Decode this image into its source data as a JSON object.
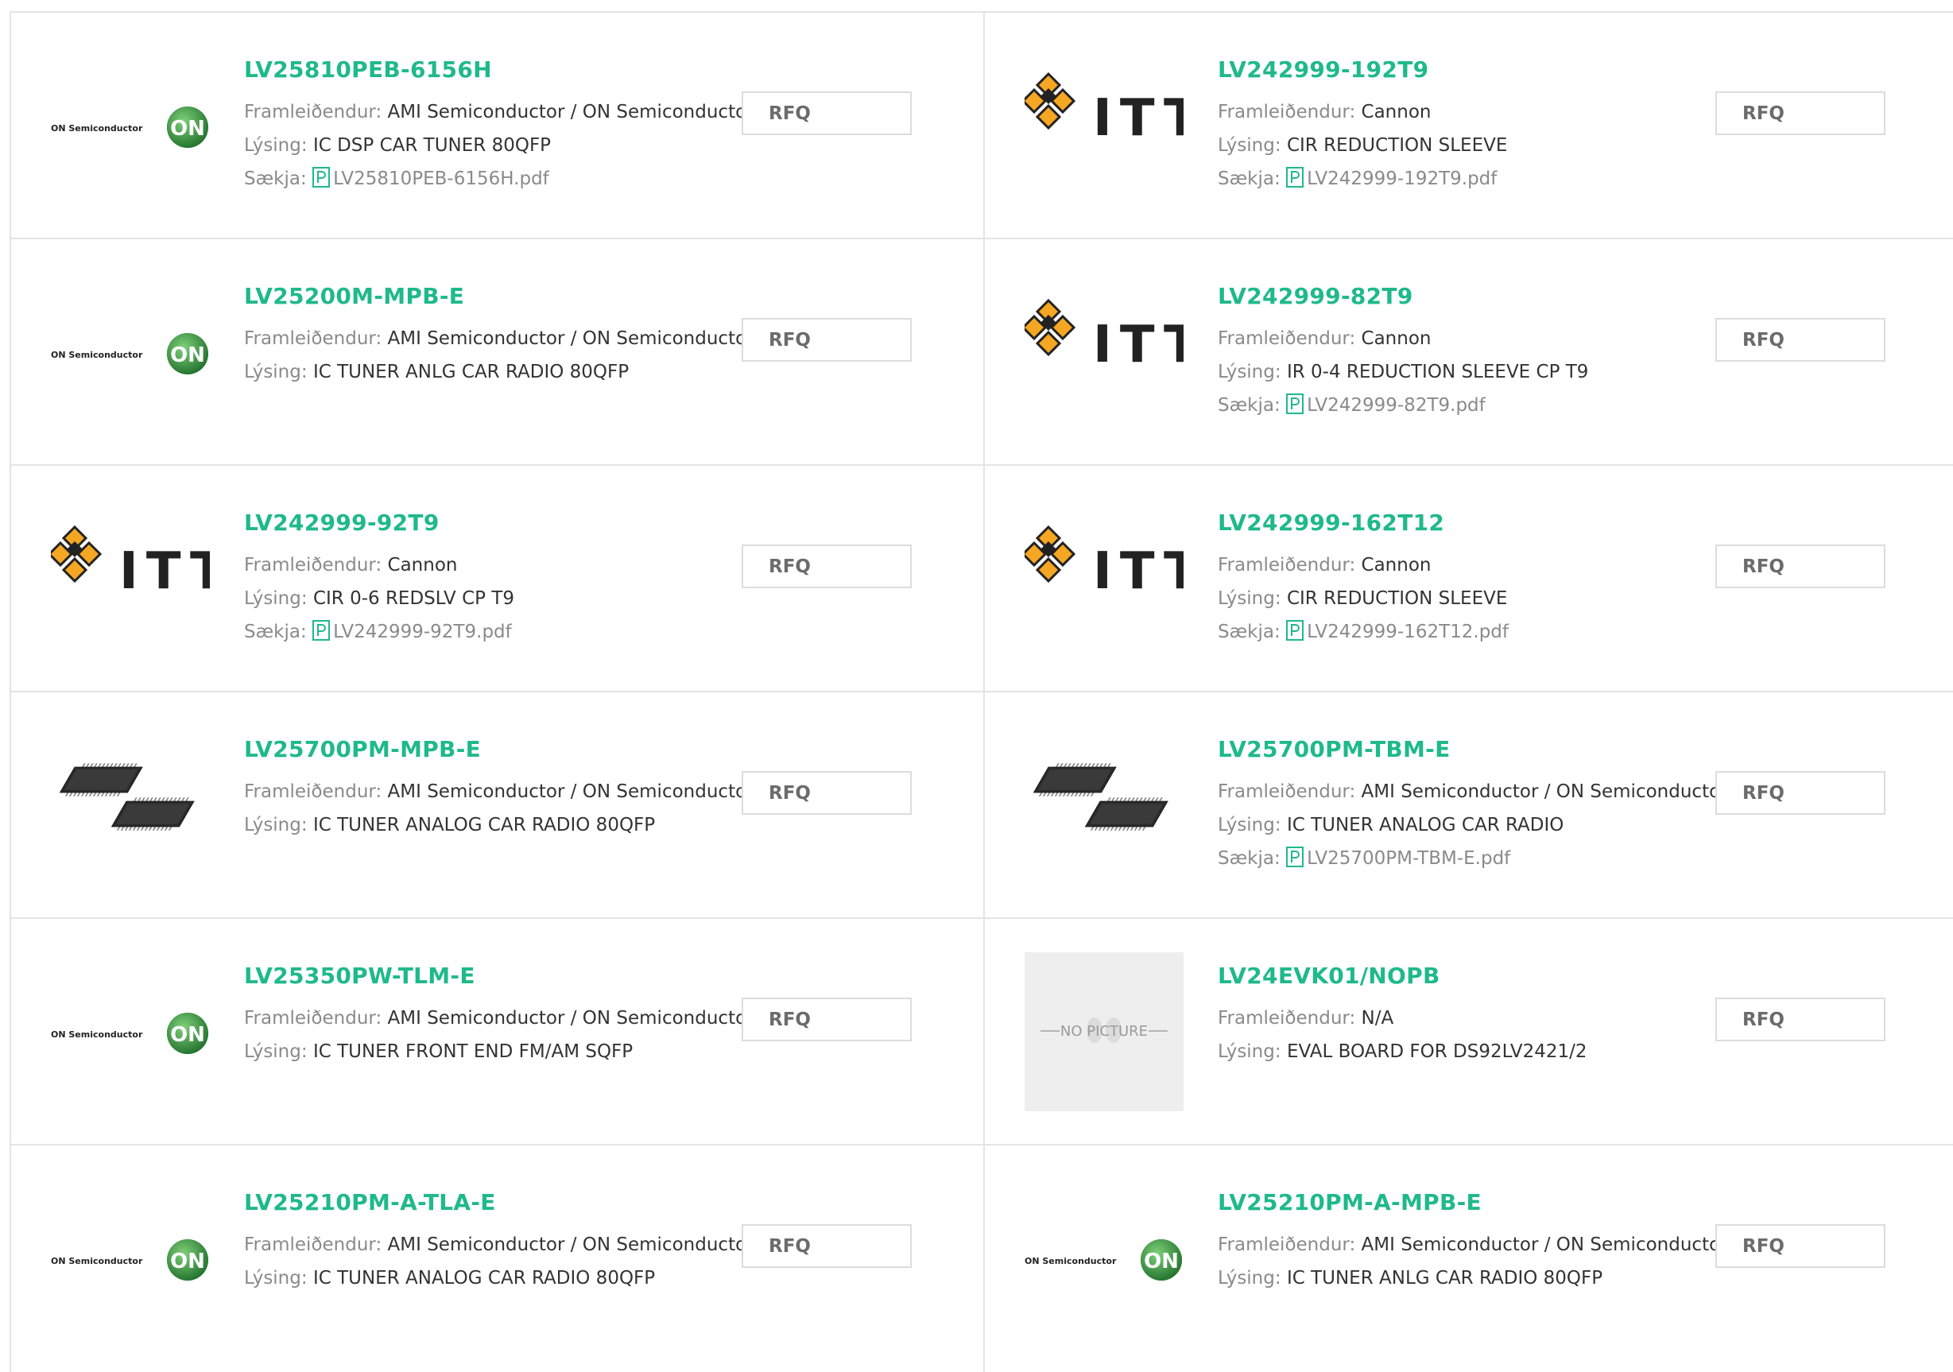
{
  "labels": {
    "manufacturer": "Framleiðendur: ",
    "description": "Lýsing: ",
    "download": "Sækja: ",
    "rfq": "RFQ",
    "no_picture": "NO PICTURE",
    "on_semi_text": "ON Semiconductor",
    "on_badge": "ON",
    "itt_text": "ITT"
  },
  "colors": {
    "part_number": "#1fb98a",
    "label_gray": "#8a8a8a",
    "on_green": "#2e8b3a",
    "itt_orange": "#f5a623"
  },
  "rows": [
    [
      {
        "part": "LV25810PEB-6156H",
        "image": "on-semiconductor-logo",
        "manufacturer": "AMI Semiconductor / ON Semiconductor",
        "description": "IC DSP CAR TUNER 80QFP",
        "pdf": "LV25810PEB-6156H.pdf"
      },
      {
        "part": "LV242999-192T9",
        "image": "itt-logo",
        "manufacturer": "Cannon",
        "description": "CIR REDUCTION SLEEVE",
        "pdf": "LV242999-192T9.pdf"
      }
    ],
    [
      {
        "part": "LV25200M-MPB-E",
        "image": "on-semiconductor-logo",
        "manufacturer": "AMI Semiconductor / ON Semiconductor",
        "description": "IC TUNER ANLG CAR RADIO 80QFP",
        "pdf": null
      },
      {
        "part": "LV242999-82T9",
        "image": "itt-logo",
        "manufacturer": "Cannon",
        "description": "IR 0-4 REDUCTION SLEEVE CP T9",
        "pdf": "LV242999-82T9.pdf"
      }
    ],
    [
      {
        "part": "LV242999-92T9",
        "image": "itt-logo",
        "manufacturer": "Cannon",
        "description": "CIR 0-6 REDSLV CP T9",
        "pdf": "LV242999-92T9.pdf"
      },
      {
        "part": "LV242999-162T12",
        "image": "itt-logo",
        "manufacturer": "Cannon",
        "description": "CIR REDUCTION SLEEVE",
        "pdf": "LV242999-162T12.pdf"
      }
    ],
    [
      {
        "part": "LV25700PM-MPB-E",
        "image": "qfp-chip-photo",
        "manufacturer": "AMI Semiconductor / ON Semiconductor",
        "description": "IC TUNER ANALOG CAR RADIO 80QFP",
        "pdf": null
      },
      {
        "part": "LV25700PM-TBM-E",
        "image": "qfp-chip-photo",
        "manufacturer": "AMI Semiconductor / ON Semiconductor",
        "description": "IC TUNER ANALOG CAR RADIO",
        "pdf": "LV25700PM-TBM-E.pdf"
      }
    ],
    [
      {
        "part": "LV25350PW-TLM-E",
        "image": "on-semiconductor-logo",
        "manufacturer": "AMI Semiconductor / ON Semiconductor",
        "description": "IC TUNER FRONT END FM/AM SQFP",
        "pdf": null
      },
      {
        "part": "LV24EVK01/NOPB",
        "image": "no-picture-placeholder",
        "manufacturer": "N/A",
        "description": "EVAL BOARD FOR DS92LV2421/2",
        "pdf": null
      }
    ],
    [
      {
        "part": "LV25210PM-A-TLA-E",
        "image": "on-semiconductor-logo",
        "manufacturer": "AMI Semiconductor / ON Semiconductor",
        "description": "IC TUNER ANALOG CAR RADIO 80QFP",
        "pdf": null
      },
      {
        "part": "LV25210PM-A-MPB-E",
        "image": "on-semiconductor-logo",
        "manufacturer": "AMI Semiconductor / ON Semiconductor",
        "description": "IC TUNER ANLG CAR RADIO 80QFP",
        "pdf": null
      }
    ]
  ]
}
